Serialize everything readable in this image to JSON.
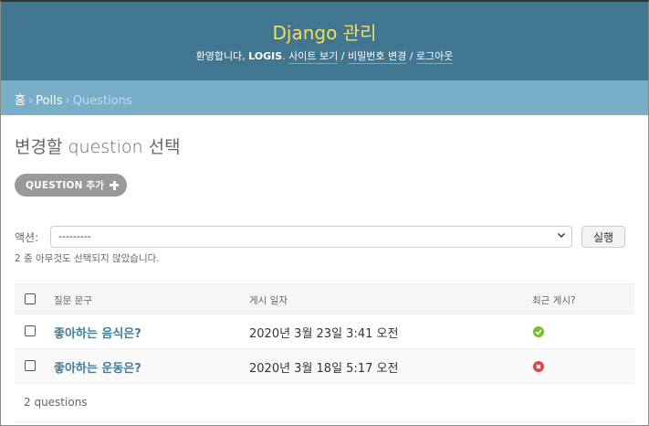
{
  "header": {
    "site_title": "Django 관리",
    "welcome": "환영합니다, ",
    "username": "LOGIS",
    "period": ". ",
    "links": [
      "사이트 보기",
      "비밀번호 변경",
      "로그아웃"
    ],
    "link_sep": " / "
  },
  "breadcrumbs": {
    "home": "홈",
    "app": "Polls",
    "current": "Questions",
    "sep": "›"
  },
  "page_title": "변경할 question 선택",
  "add_button": {
    "label": "QUESTION 추가"
  },
  "actions": {
    "label": "액션:",
    "selected": "---------",
    "go_label": "실행",
    "counter": "2 중 아무것도 선택되지 않았습니다."
  },
  "table": {
    "headers": [
      "질문 문구",
      "게시 일자",
      "최근 게시?"
    ],
    "rows": [
      {
        "question_text": "좋아하는 음식은?",
        "pub_date": "2020년 3월 23일 3:41 오전",
        "recent": "yes"
      },
      {
        "question_text": "좋아하는 운동은?",
        "pub_date": "2020년 3월 18일 5:17 오전",
        "recent": "no"
      }
    ]
  },
  "paginator": {
    "count_text": "2 questions"
  },
  "colors": {
    "header_bg": "#417690",
    "branding": "#f5dd5d",
    "breadcrumbs_bg": "#79aec8",
    "link": "#447e9b",
    "status_yes": "#70bf2b",
    "status_no": "#dd4646"
  }
}
